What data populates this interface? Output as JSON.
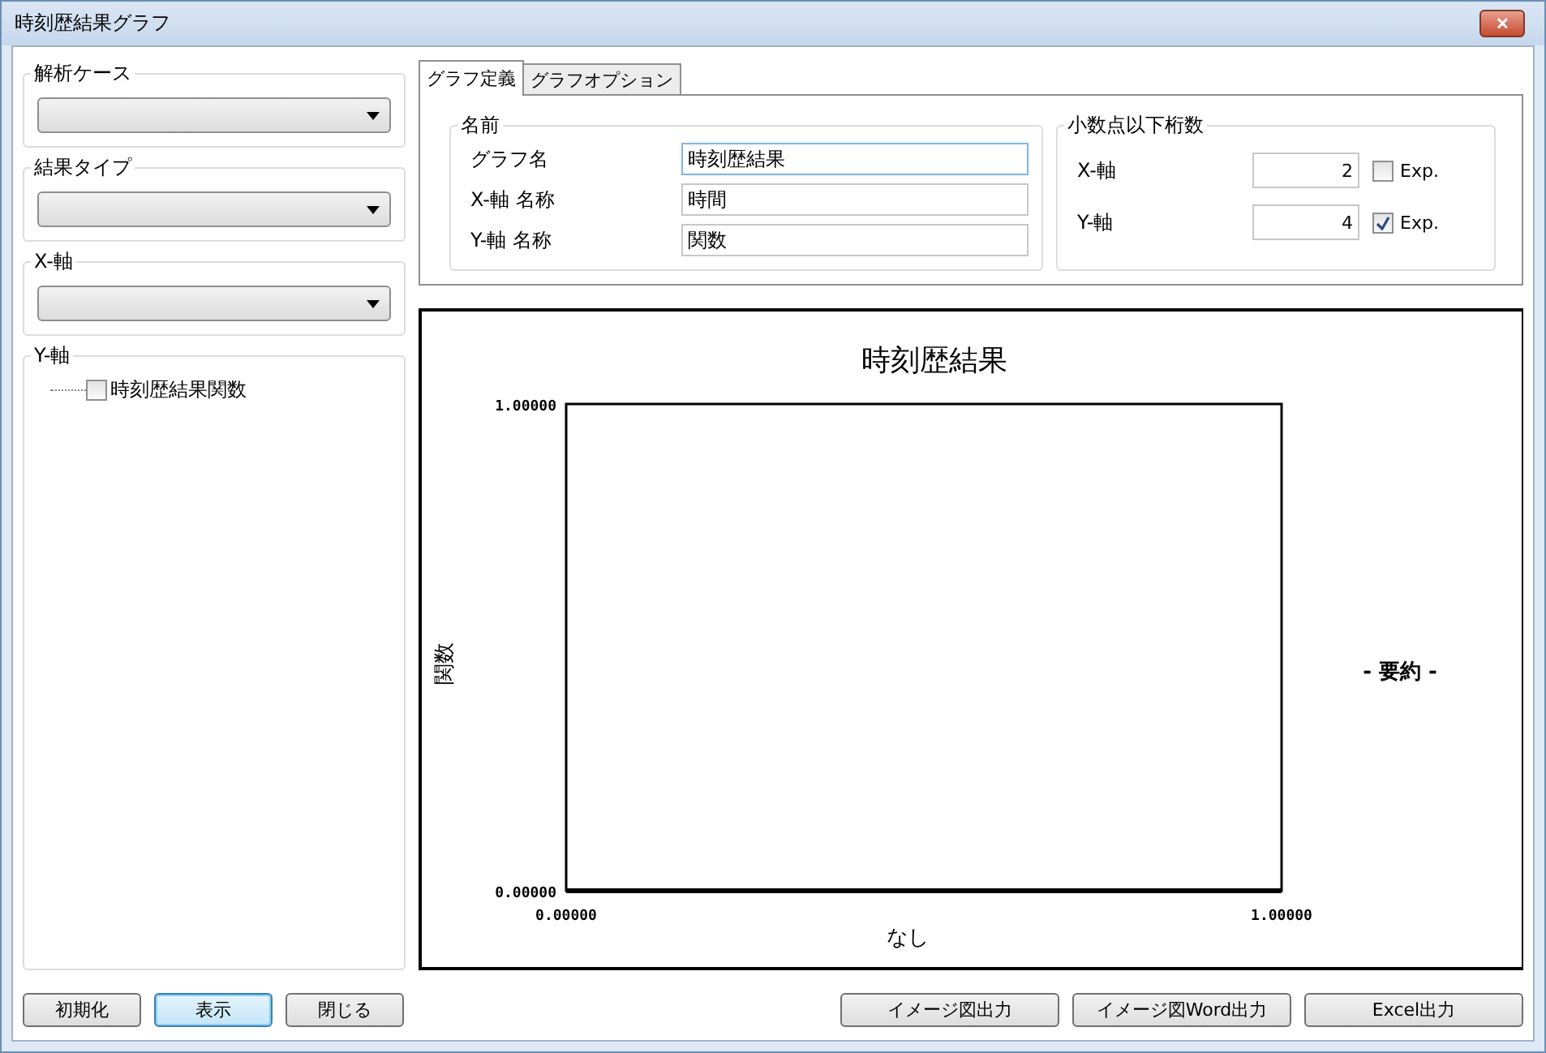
{
  "window": {
    "title": "時刻歴結果グラフ",
    "close": "✕"
  },
  "sidebar": {
    "groups": [
      {
        "kind": "dropdown",
        "label": "解析ケース"
      },
      {
        "kind": "dropdown",
        "label": "結果タイプ"
      },
      {
        "kind": "dropdown",
        "label": "X-軸"
      },
      {
        "kind": "tree",
        "label": "Y-軸",
        "items": [
          {
            "label": "時刻歴結果関数",
            "checked": false
          }
        ]
      }
    ]
  },
  "tabs": [
    {
      "label": "グラフ定義",
      "selected": true
    },
    {
      "label": "グラフオプション",
      "selected": false
    }
  ],
  "name_group": {
    "title": "名前",
    "fields": [
      {
        "label": "グラフ名",
        "value": "時刻歴結果",
        "focused": true
      },
      {
        "label": "X-軸 名称",
        "value": "時間",
        "focused": false
      },
      {
        "label": "Y-軸 名称",
        "value": "関数",
        "focused": false
      }
    ]
  },
  "decimals_group": {
    "title": "小数点以下桁数",
    "rows": [
      {
        "label": "X-軸",
        "value": "2",
        "exp_label": "Exp.",
        "exp_checked": false
      },
      {
        "label": "Y-軸",
        "value": "4",
        "exp_label": "Exp.",
        "exp_checked": true
      }
    ]
  },
  "chart": {
    "legend_title": "- 要約 -",
    "chart_data": {
      "type": "line",
      "title": "時刻歴結果",
      "xlabel": "なし",
      "ylabel": "関数",
      "xlim": [
        0,
        1
      ],
      "ylim": [
        0,
        1
      ],
      "xticks": [
        {
          "value": 0,
          "label": "0.00000"
        },
        {
          "value": 1,
          "label": "1.00000"
        }
      ],
      "yticks": [
        {
          "value": 0,
          "label": "0.00000"
        },
        {
          "value": 1,
          "label": "1.00000"
        }
      ]
    }
  },
  "buttons_left": [
    {
      "label": "初期化",
      "focused": false
    },
    {
      "label": "表示",
      "focused": true
    },
    {
      "label": "閉じる",
      "focused": false
    }
  ],
  "buttons_right": [
    {
      "label": "イメージ図出力",
      "focused": false
    },
    {
      "label": "イメージ図Word出力",
      "focused": false
    },
    {
      "label": "Excel出力",
      "focused": false
    }
  ]
}
